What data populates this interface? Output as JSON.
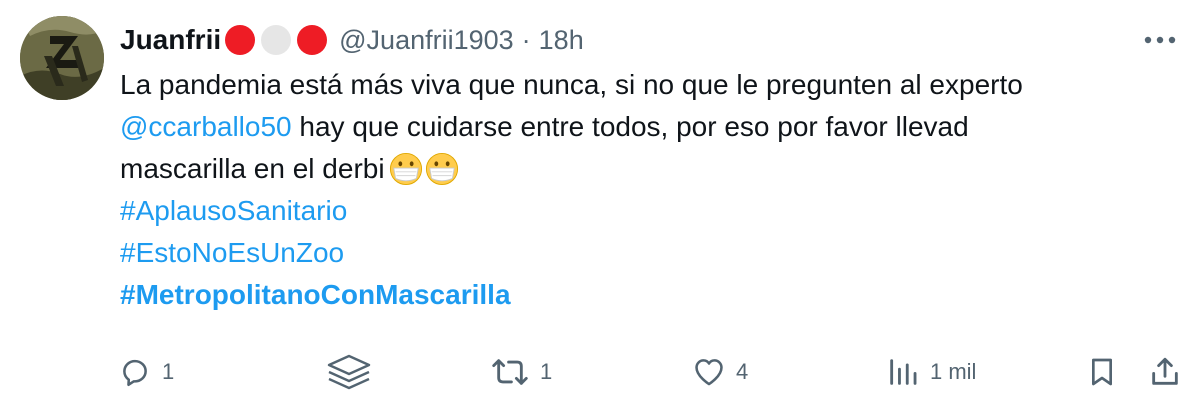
{
  "author": {
    "display_name": "Juanfrii",
    "name_emojis": [
      "#ee1c25",
      "#e6e6e6",
      "#ee1c25"
    ],
    "handle": "@Juanfrii1903",
    "separator": "·",
    "time": "18h"
  },
  "tweet": {
    "line1": "La pandemia está más viva que nunca, si no que le pregunten al experto",
    "mention": "@ccarballo50",
    "line2_rest": " hay que cuidarse entre todos, por eso por favor llevad",
    "line3": "mascarilla en el derbi",
    "line3_emojis": [
      "face-with-medical-mask-icon",
      "face-with-medical-mask-icon"
    ],
    "hashtags": [
      "#AplausoSanitario",
      "#EstoNoEsUnZoo",
      "#MetropolitanoConMascarilla"
    ]
  },
  "actions": {
    "reply_count": "1",
    "retweet_count": "1",
    "like_count": "4",
    "views_count": "1 mil"
  },
  "colors": {
    "link": "#1d9bf0",
    "secondary_text": "#536471",
    "primary_text": "#0f1419"
  }
}
